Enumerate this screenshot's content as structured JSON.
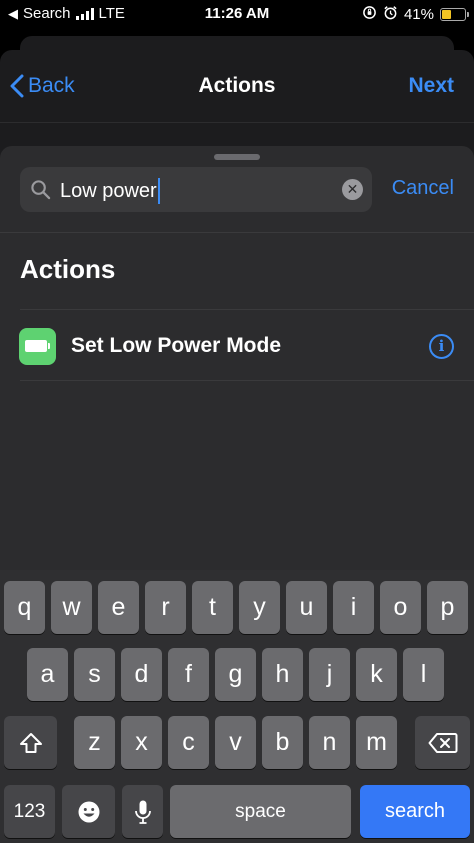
{
  "status_bar": {
    "carrier": "Search",
    "network": "LTE",
    "time": "11:26 AM",
    "battery_percent": "41%",
    "battery_level": 0.41,
    "battery_color": "#f4c524"
  },
  "nav": {
    "back_label": "Back",
    "title": "Actions",
    "next_label": "Next"
  },
  "search": {
    "value": "Low power",
    "cancel_label": "Cancel",
    "clear_glyph": "✕"
  },
  "results": {
    "section_title": "Actions",
    "items": [
      {
        "label": "Set Low Power Mode",
        "icon": "battery-icon",
        "icon_color": "#5ed271",
        "info_glyph": "i"
      }
    ]
  },
  "keyboard": {
    "row1": [
      "q",
      "w",
      "e",
      "r",
      "t",
      "y",
      "u",
      "i",
      "o",
      "p"
    ],
    "row2": [
      "a",
      "s",
      "d",
      "f",
      "g",
      "h",
      "j",
      "k",
      "l"
    ],
    "row3": [
      "z",
      "x",
      "c",
      "v",
      "b",
      "n",
      "m"
    ],
    "numbers_label": "123",
    "space_label": "space",
    "return_label": "search"
  },
  "colors": {
    "accent": "#3b8cf5",
    "return_key": "#3478f6"
  }
}
